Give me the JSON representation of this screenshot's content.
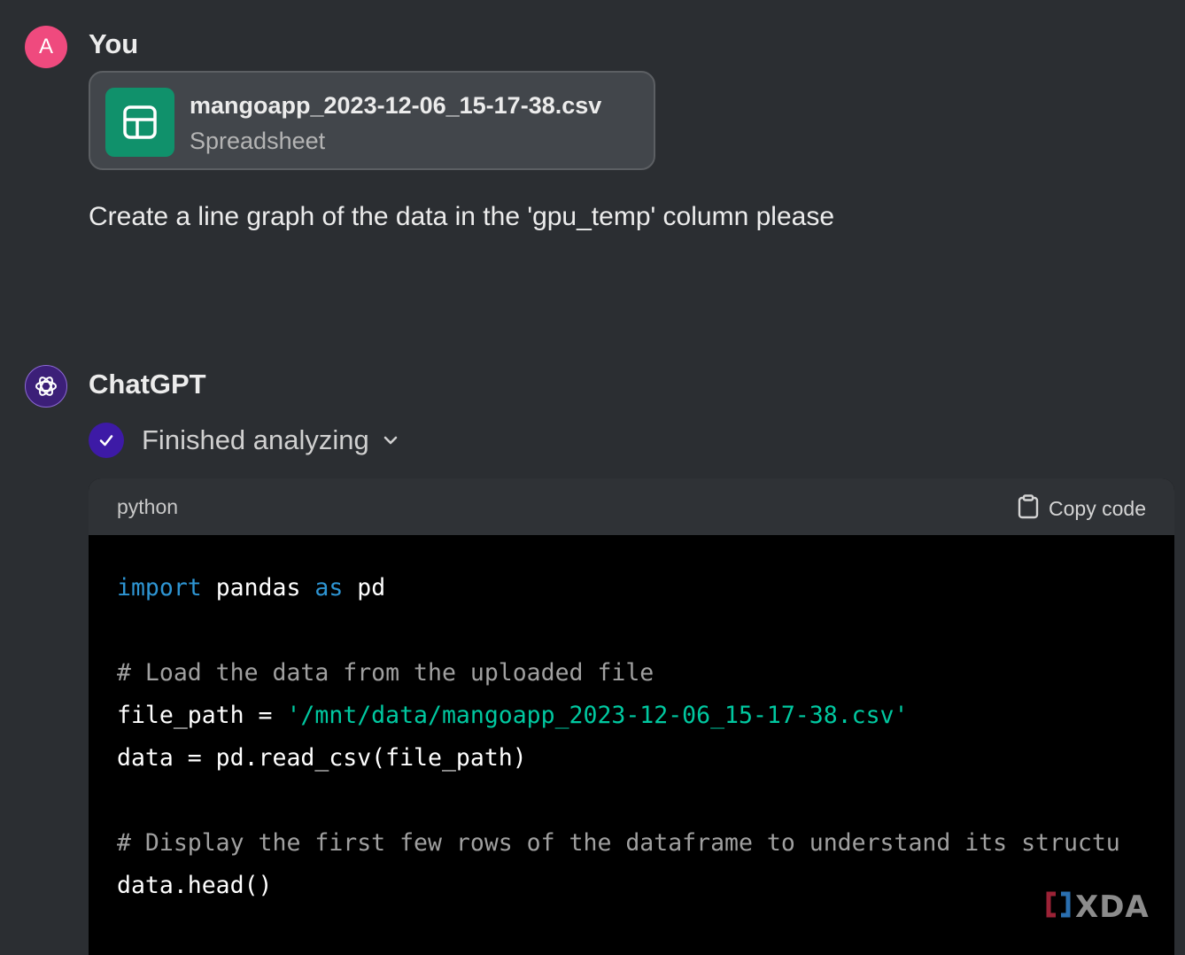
{
  "user": {
    "avatar_letter": "A",
    "name": "You",
    "attachment": {
      "filename": "mangoapp_2023-12-06_15-17-38.csv",
      "type": "Spreadsheet",
      "icon": "spreadsheet-icon"
    },
    "message": "Create a line graph of the data in the 'gpu_temp' column please"
  },
  "assistant": {
    "name": "ChatGPT",
    "avatar_icon": "openai-logo-icon",
    "status": "Finished analyzing",
    "code_block": {
      "language": "python",
      "copy_label": "Copy code",
      "lines": [
        {
          "tokens": [
            {
              "t": "import",
              "c": "kw"
            },
            {
              "t": " pandas ",
              "c": ""
            },
            {
              "t": "as",
              "c": "kw"
            },
            {
              "t": " pd",
              "c": ""
            }
          ]
        },
        {
          "tokens": []
        },
        {
          "tokens": [
            {
              "t": "# Load the data from the uploaded file",
              "c": "cm"
            }
          ]
        },
        {
          "tokens": [
            {
              "t": "file_path = ",
              "c": ""
            },
            {
              "t": "'/mnt/data/mangoapp_2023-12-06_15-17-38.csv'",
              "c": "str"
            }
          ]
        },
        {
          "tokens": [
            {
              "t": "data = pd.read_csv(file_path)",
              "c": ""
            }
          ]
        },
        {
          "tokens": []
        },
        {
          "tokens": [
            {
              "t": "# Display the first few rows of the dataframe to understand its structu",
              "c": "cm"
            }
          ]
        },
        {
          "tokens": [
            {
              "t": "data.head()",
              "c": ""
            }
          ]
        }
      ]
    }
  },
  "watermark": {
    "text": "XDA"
  },
  "colors": {
    "background": "#2b2e32",
    "avatar_user": "#ef4a7e",
    "avatar_gpt": "#3c1f78",
    "file_icon": "#10916b",
    "check_badge": "#3d1aa6",
    "keyword": "#2e95d3",
    "string": "#00c8a0",
    "comment": "#a0a0a0"
  }
}
